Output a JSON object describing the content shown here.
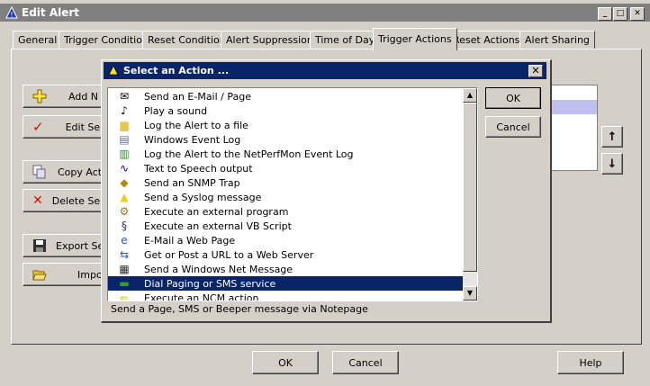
{
  "window": {
    "title": "Edit Alert",
    "min": "_",
    "max": "□",
    "close": "✕"
  },
  "tabs": [
    {
      "label": "General"
    },
    {
      "label": "Trigger Condition"
    },
    {
      "label": "Reset Condition"
    },
    {
      "label": "Alert Suppression"
    },
    {
      "label": "Time of Day"
    },
    {
      "label": "Trigger Actions"
    },
    {
      "label": "Reset Actions"
    },
    {
      "label": "Alert Sharing"
    }
  ],
  "side_buttons": [
    {
      "label": "Add N",
      "icon": "plus-icon"
    },
    {
      "label": "Edit Sele",
      "icon": "checkmark-icon"
    },
    {
      "label": "Copy Actio",
      "icon": "copy-icon"
    },
    {
      "label": "Delete Sele",
      "icon": "delete-x-icon"
    },
    {
      "label": "Export Sel",
      "icon": "save-icon"
    },
    {
      "label": "Impor",
      "icon": "folder-open-icon"
    }
  ],
  "move_buttons": {
    "up": "↑",
    "down": "↓"
  },
  "bottom_buttons": {
    "ok": "OK",
    "cancel": "Cancel",
    "help": "Help"
  },
  "dialog": {
    "title": "Select an Action ...",
    "close": "✕",
    "ok": "OK",
    "cancel": "Cancel",
    "description": "Send a Page, SMS or Beeper message via Notepage",
    "actions": [
      {
        "label": "Send an E-Mail / Page",
        "icon": "envelope-icon",
        "glyph": "✉",
        "color": "#000000"
      },
      {
        "label": "Play a sound",
        "icon": "music-note-icon",
        "glyph": "♪",
        "color": "#000000"
      },
      {
        "label": "Log the Alert to a file",
        "icon": "folder-icon",
        "glyph": "▆",
        "color": "#e8c84a"
      },
      {
        "label": "Windows Event Log",
        "icon": "event-log-icon",
        "glyph": "▤",
        "color": "#6a6a9a"
      },
      {
        "label": "Log the Alert to the NetPerfMon Event Log",
        "icon": "chart-log-icon",
        "glyph": "▥",
        "color": "#2a8a2a"
      },
      {
        "label": "Text to Speech output",
        "icon": "waveform-icon",
        "glyph": "∿",
        "color": "#0000aa"
      },
      {
        "label": "Send an SNMP Trap",
        "icon": "snmp-trap-icon",
        "glyph": "◆",
        "color": "#b08a10"
      },
      {
        "label": "Send a Syslog message",
        "icon": "warning-triangle-icon",
        "glyph": "▲",
        "color": "#e8d020"
      },
      {
        "label": "Execute an external program",
        "icon": "gear-icon",
        "glyph": "⚙",
        "color": "#a07020"
      },
      {
        "label": "Execute an external VB Script",
        "icon": "script-icon",
        "glyph": "§",
        "color": "#2a2a6a"
      },
      {
        "label": "E-Mail a Web Page",
        "icon": "ie-browser-icon",
        "glyph": "e",
        "color": "#1a5ad0"
      },
      {
        "label": "Get or Post a URL to a Web Server",
        "icon": "web-server-icon",
        "glyph": "⇆",
        "color": "#1a5ad0"
      },
      {
        "label": "Send a Windows Net Message",
        "icon": "net-message-icon",
        "glyph": "▦",
        "color": "#303030"
      },
      {
        "label": "Dial Paging or SMS service",
        "icon": "pager-icon",
        "glyph": "▬",
        "color": "#30a030"
      },
      {
        "label": "Execute an NCM action",
        "icon": "ncm-icon",
        "glyph": "⇐",
        "color": "#d0c020"
      }
    ],
    "selected_index": 13
  }
}
